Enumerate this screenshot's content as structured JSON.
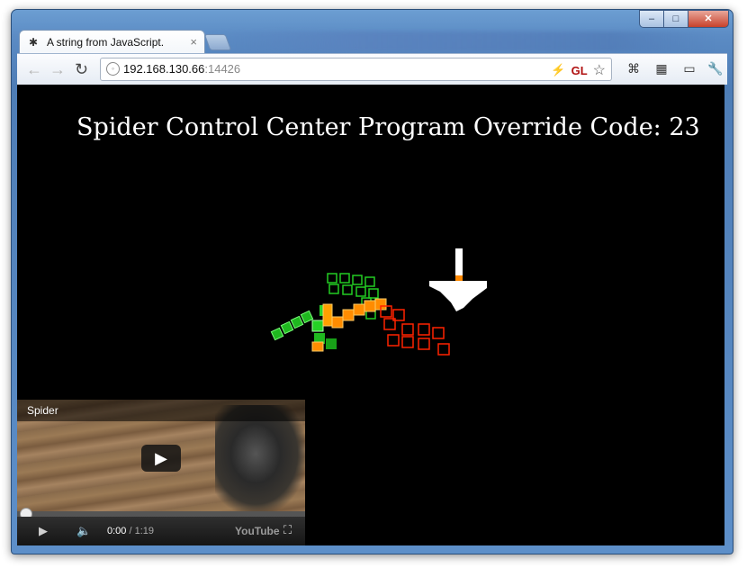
{
  "browser": {
    "tab_title": "A string from JavaScript.",
    "url_host": "192.168.130.66",
    "url_port": ":14426",
    "window_buttons": [
      "–",
      "□",
      "✕"
    ]
  },
  "page": {
    "heading": "Spider Control Center Program Override Code: 23"
  },
  "video": {
    "title": "Spider",
    "time_current": "0:00",
    "time_duration": "1:19",
    "brand": "YouTube",
    "progress": 0.0
  },
  "colors": {
    "green": "#22cc22",
    "orange": "#ff8800",
    "red": "#ff2200",
    "white": "#ffffff"
  }
}
